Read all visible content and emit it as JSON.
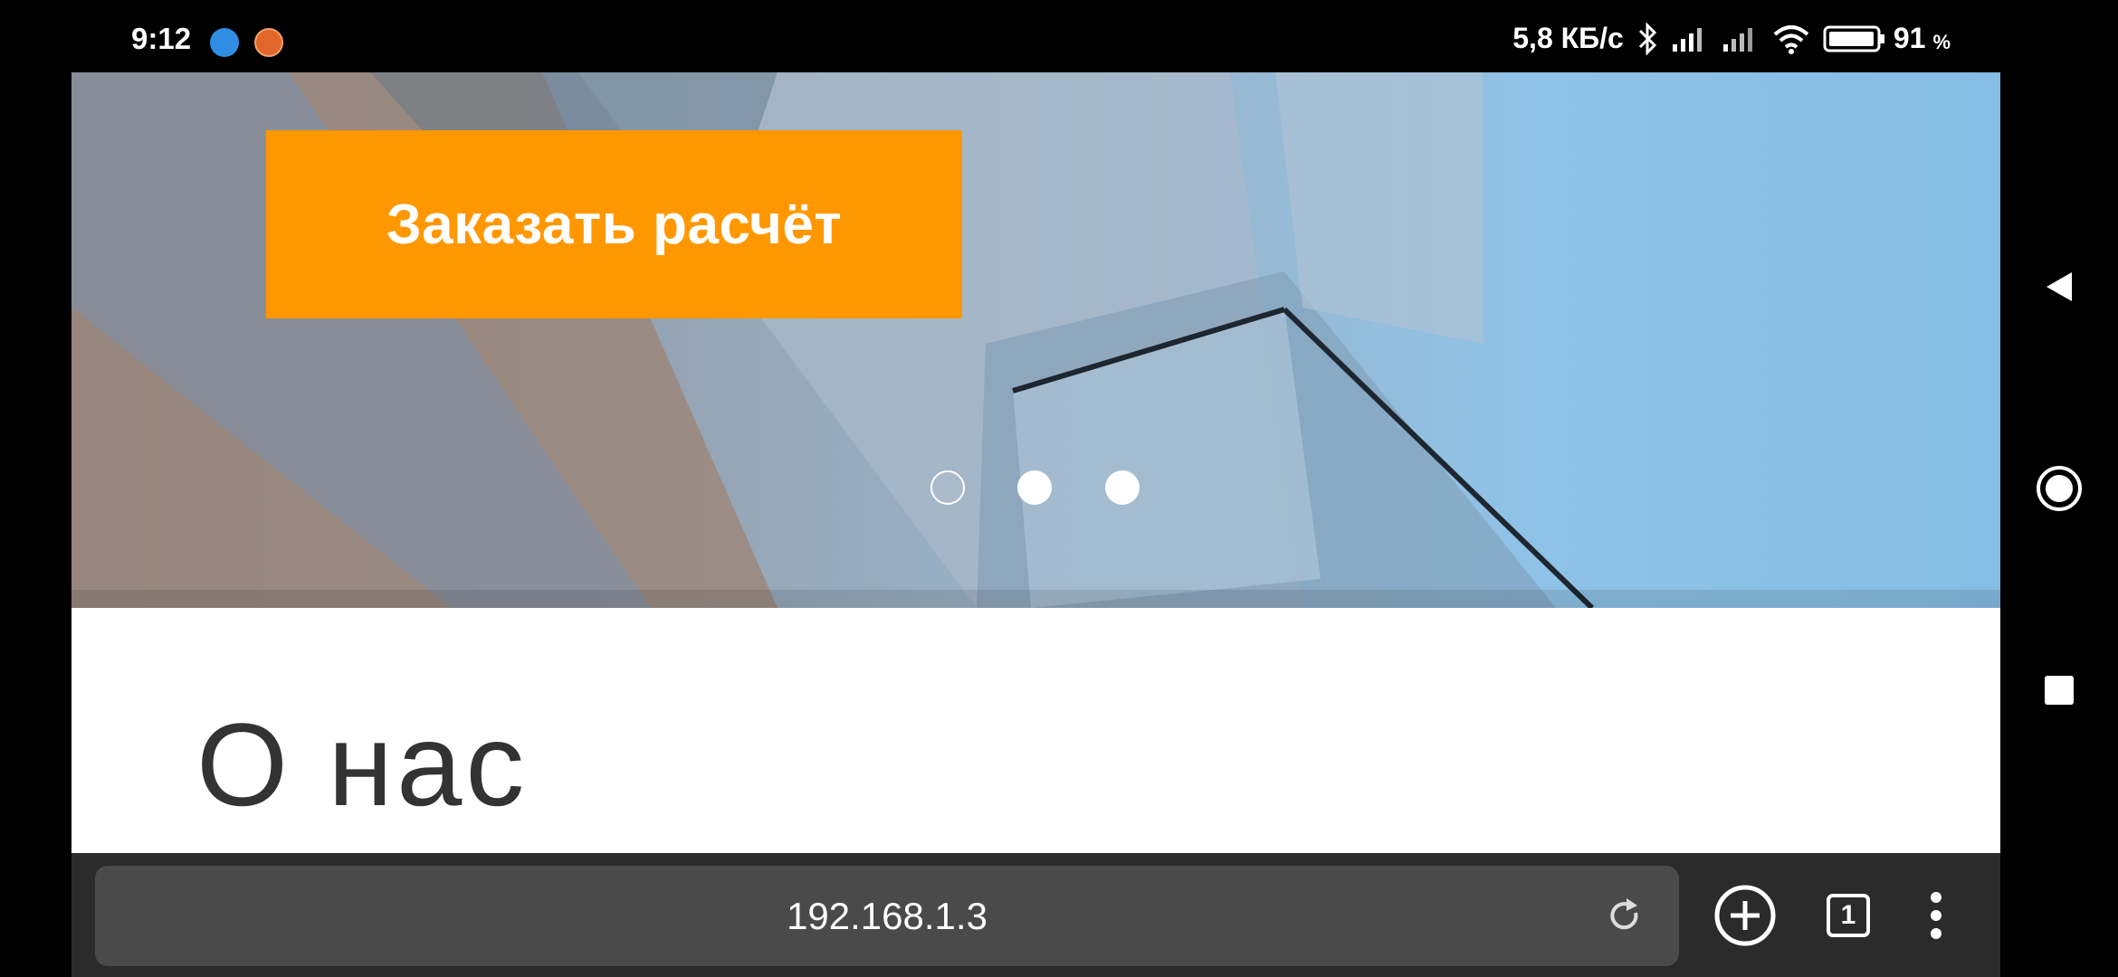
{
  "status_bar": {
    "time": "9:12",
    "network_speed": "5,8 КБ/с",
    "battery_level": "91",
    "battery_unit": "%"
  },
  "hero": {
    "cta_label": "Заказать расчёт",
    "slider_dots": 3,
    "active_dot": 1,
    "accent_color": "#ff9800"
  },
  "section": {
    "title": "О нас"
  },
  "browser": {
    "url": "192.168.1.3",
    "tab_count": "1"
  },
  "icons": [
    "bluetooth-icon",
    "signal-icon",
    "wifi-icon",
    "battery-icon",
    "reload-icon",
    "new-tab-icon",
    "tabs-icon",
    "menu-icon",
    "back-icon",
    "home-icon",
    "recents-icon"
  ]
}
